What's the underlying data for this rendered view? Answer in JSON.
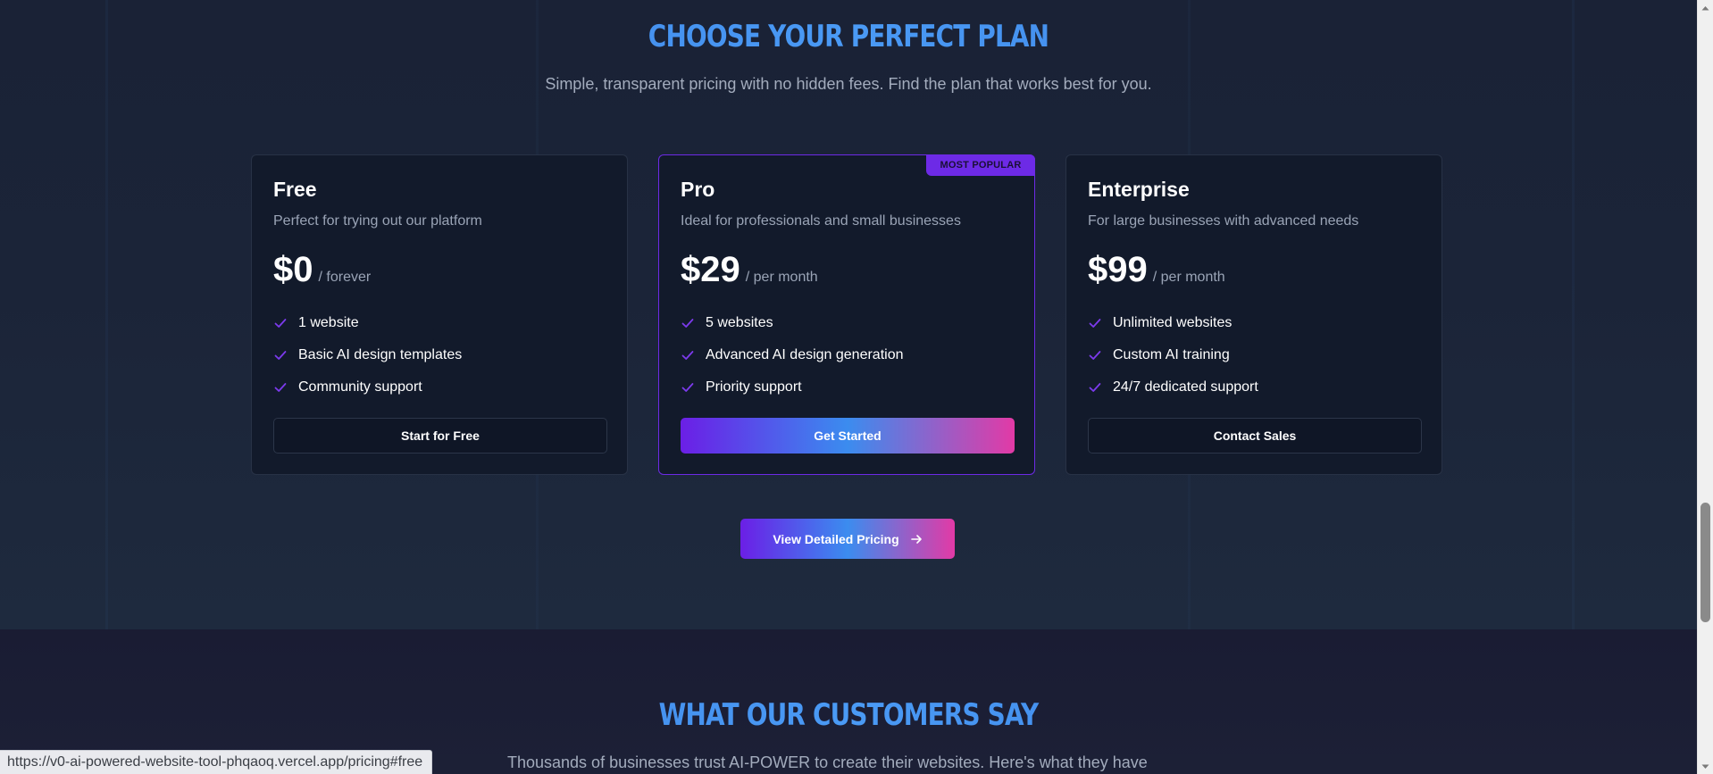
{
  "pricing": {
    "heading": "CHOOSE YOUR PERFECT PLAN",
    "subheading": "Simple, transparent pricing with no hidden fees. Find the plan that works best for you.",
    "plans": [
      {
        "name": "Free",
        "description": "Perfect for trying out our platform",
        "price": "$0",
        "period": "/ forever",
        "features": [
          "1 website",
          "Basic AI design templates",
          "Community support"
        ],
        "cta": "Start for Free"
      },
      {
        "name": "Pro",
        "badge": "MOST POPULAR",
        "description": "Ideal for professionals and small businesses",
        "price": "$29",
        "period": "/ per month",
        "features": [
          "5 websites",
          "Advanced AI design generation",
          "Priority support"
        ],
        "cta": "Get Started"
      },
      {
        "name": "Enterprise",
        "description": "For large businesses with advanced needs",
        "price": "$99",
        "period": "/ per month",
        "features": [
          "Unlimited websites",
          "Custom AI training",
          "24/7 dedicated support"
        ],
        "cta": "Contact Sales"
      }
    ],
    "detail_button": "View Detailed Pricing"
  },
  "testimonials": {
    "heading": "WHAT OUR CUSTOMERS SAY",
    "subheading": "Thousands of businesses trust AI-POWER to create their websites. Here's what they have"
  },
  "status_bar": {
    "url": "https://v0-ai-powered-website-tool-phqaoq.vercel.app/pricing#free"
  },
  "colors": {
    "accent_purple": "#6d2ae6",
    "accent_blue": "#3b8ae8",
    "accent_pink": "#e23aa6",
    "background": "#1a2236",
    "card_background": "#121a2b"
  },
  "icons": {
    "feature": "check-icon",
    "detail_button": "arrow-right-icon"
  }
}
